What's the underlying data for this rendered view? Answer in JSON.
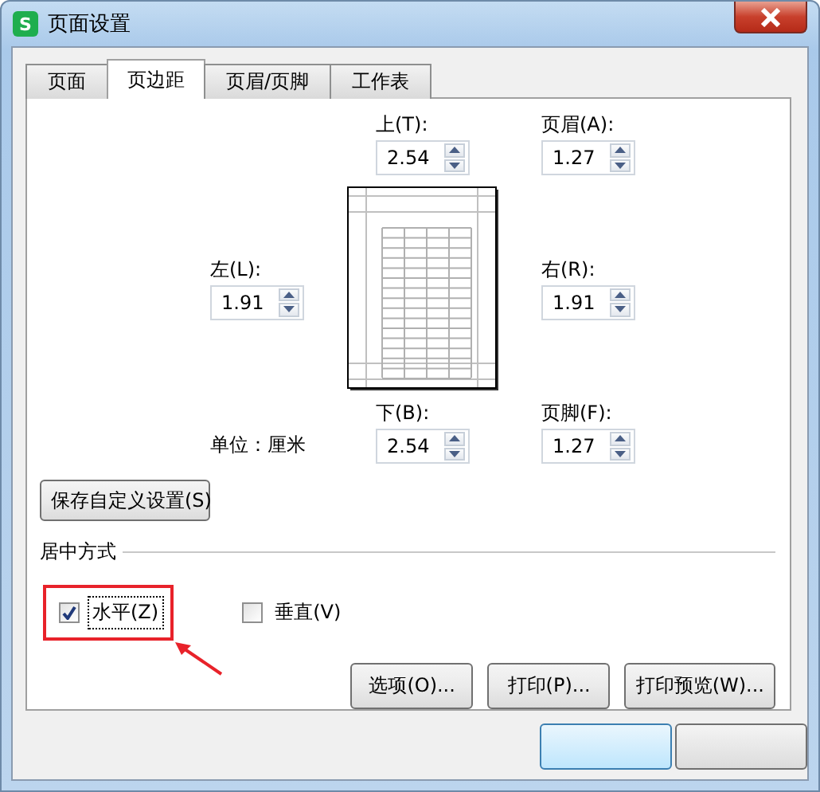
{
  "window": {
    "icon_letter": "S",
    "title": "页面设置"
  },
  "tabs": [
    {
      "label": "页面",
      "selected": false
    },
    {
      "label": "页边距",
      "selected": true
    },
    {
      "label": "页眉/页脚",
      "selected": false
    },
    {
      "label": "工作表",
      "selected": false
    }
  ],
  "margins": {
    "top": {
      "label": "上(T):",
      "value": "2.54"
    },
    "header": {
      "label": "页眉(A):",
      "value": "1.27"
    },
    "left": {
      "label": "左(L):",
      "value": "1.91"
    },
    "right": {
      "label": "右(R):",
      "value": "1.91"
    },
    "bottom": {
      "label": "下(B):",
      "value": "2.54"
    },
    "footer": {
      "label": "页脚(F):",
      "value": "1.27"
    },
    "unit": "单位：厘米"
  },
  "save_button": "保存自定义设置(S)",
  "centering": {
    "title": "居中方式",
    "options": [
      {
        "label": "水平(Z)",
        "checked": true,
        "focused": true,
        "highlighted": true
      },
      {
        "label": "垂直(V)",
        "checked": false,
        "focused": false,
        "highlighted": false
      }
    ]
  },
  "buttons": [
    "选项(O)...",
    "打印(P)...",
    "打印预览(W)..."
  ]
}
